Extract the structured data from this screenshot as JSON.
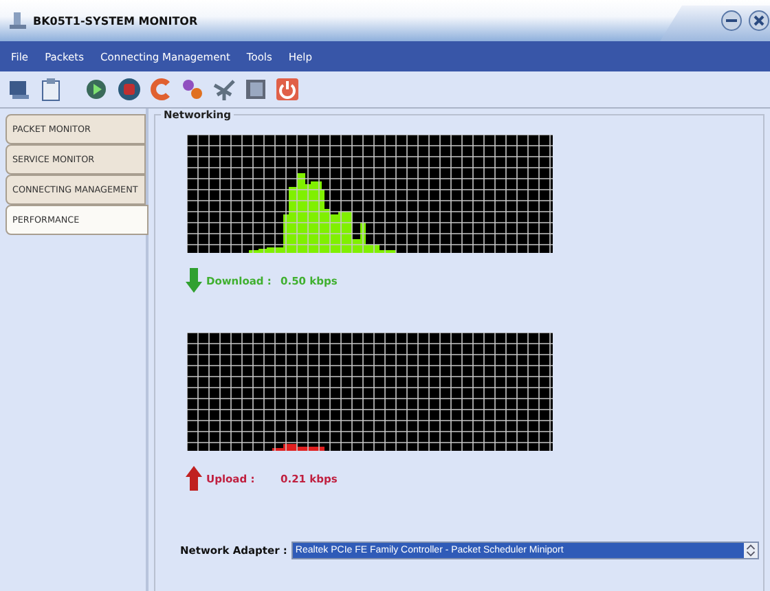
{
  "window": {
    "title": "BK05T1-SYSTEM MONITOR"
  },
  "menu": [
    "File",
    "Packets",
    "Connecting Management",
    "Tools",
    "Help"
  ],
  "tabs": [
    {
      "label": "PACKET MONITOR",
      "selected": false
    },
    {
      "label": "SERVICE MONITOR",
      "selected": false
    },
    {
      "label": "CONNECTING MANAGEMENT",
      "selected": false
    },
    {
      "label": "PERFORMANCE",
      "selected": true
    }
  ],
  "panel": {
    "title": "Networking",
    "download": {
      "label": "Download :",
      "value": "0.50 kbps"
    },
    "upload": {
      "label": "Upload :",
      "value": "0.21 kbps"
    },
    "adapter": {
      "label": "Network Adapter :",
      "value": "Realtek PCIe FE Family Controller - Packet Scheduler Miniport"
    }
  }
}
